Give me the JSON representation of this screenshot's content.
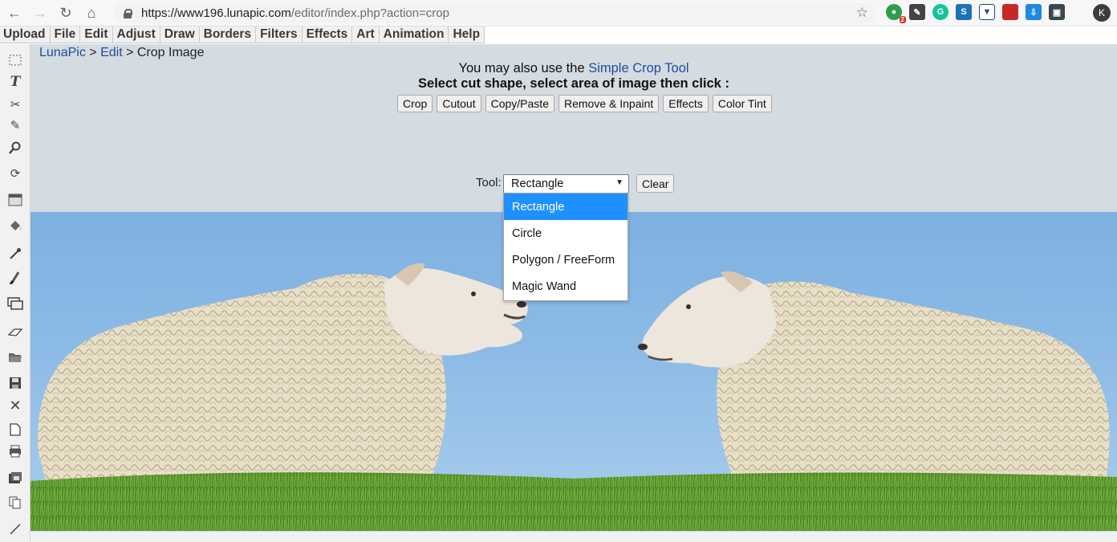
{
  "browser": {
    "url_main": "https://www196.lunapic.com",
    "url_path": "/editor/index.php?action=crop",
    "extension_badge": "2",
    "profile_initial": "K",
    "icons": [
      "back-icon",
      "forward-icon",
      "reload-icon",
      "home-icon",
      "lock-icon",
      "star-icon"
    ]
  },
  "menu": {
    "items": [
      "Upload",
      "File",
      "Edit",
      "Adjust",
      "Draw",
      "Borders",
      "Filters",
      "Effects",
      "Art",
      "Animation",
      "Help"
    ]
  },
  "toolbar": {
    "tools": [
      "select-icon",
      "text-icon",
      "scissors-icon",
      "pencil-icon",
      "zoom-icon",
      "rotate-icon",
      "layer-icon",
      "fill-icon",
      "eyedropper-icon",
      "brush-icon",
      "image-icon",
      "eraser-icon",
      "open-icon",
      "save-icon",
      "close-icon",
      "new-file-icon",
      "print-icon",
      "stack-icon",
      "copy-icon",
      "line-icon"
    ]
  },
  "breadcrumb": {
    "home": "LunaPic",
    "sep1": " > ",
    "section": "Edit",
    "sep2": " > ",
    "current": "Crop Image"
  },
  "crop": {
    "hint_prefix": "You may also use the ",
    "hint_link": "Simple Crop Tool",
    "instruction": "Select cut shape, select area of image then click :",
    "buttons": [
      "Crop",
      "Cutout",
      "Copy/Paste",
      "Remove & Inpaint",
      "Effects",
      "Color Tint"
    ],
    "tool_label": "Tool:",
    "tool_selected": "Rectangle",
    "tool_options": [
      "Rectangle",
      "Circle",
      "Polygon / FreeForm",
      "Magic Wand"
    ],
    "clear_label": "Clear"
  },
  "colors": {
    "link": "#1f4e9c",
    "panel_bg": "#d4dbe1",
    "dropdown_highlight": "#1e90ff",
    "sky": "#8dbbe6",
    "grass": "#4f8a2a"
  }
}
